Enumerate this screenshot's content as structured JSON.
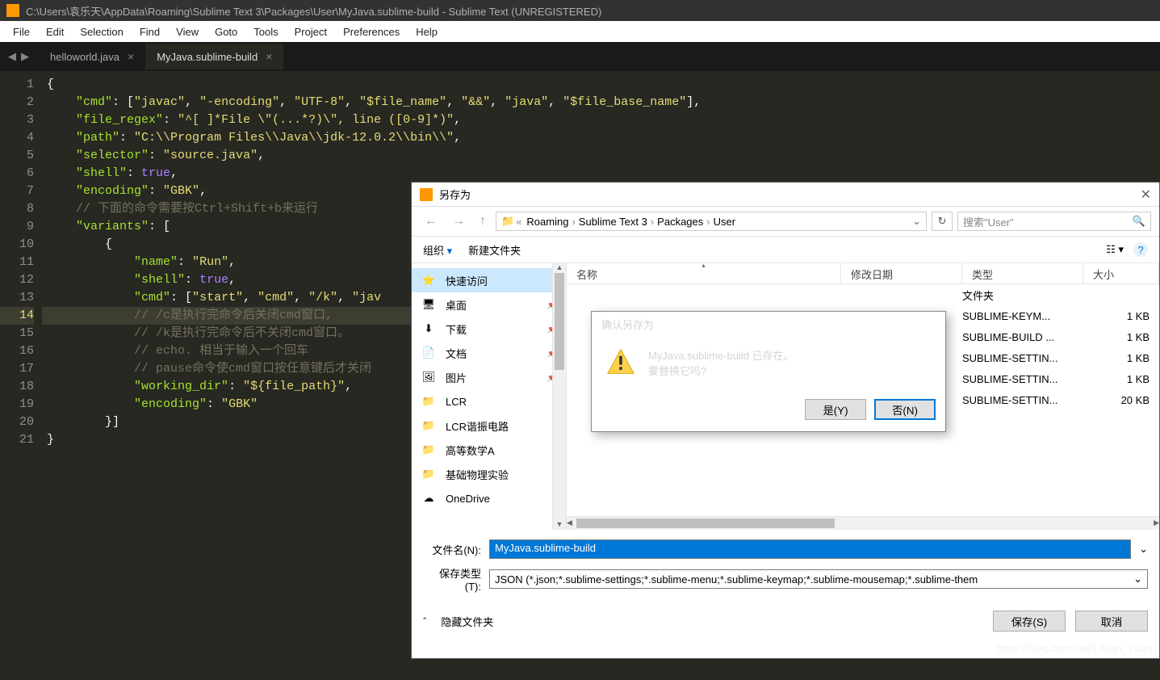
{
  "titlebar": {
    "path": "C:\\Users\\袁乐天\\AppData\\Roaming\\Sublime Text 3\\Packages\\User\\MyJava.sublime-build - Sublime Text (UNREGISTERED)"
  },
  "menu": [
    "File",
    "Edit",
    "Selection",
    "Find",
    "View",
    "Goto",
    "Tools",
    "Project",
    "Preferences",
    "Help"
  ],
  "tabs": [
    {
      "label": "helloworld.java",
      "active": false
    },
    {
      "label": "MyJava.sublime-build",
      "active": true
    }
  ],
  "code_lines": [
    {
      "n": 1,
      "html": "<span class='s-p'>{</span>"
    },
    {
      "n": 2,
      "html": "    <span class='s-k'>\"cmd\"</span><span class='s-p'>: [</span><span class='s-s'>\"javac\"</span><span class='s-p'>, </span><span class='s-s'>\"-encoding\"</span><span class='s-p'>, </span><span class='s-s'>\"UTF-8\"</span><span class='s-p'>, </span><span class='s-s'>\"$file_name\"</span><span class='s-p'>, </span><span class='s-s'>\"&amp;&amp;\"</span><span class='s-p'>, </span><span class='s-s'>\"java\"</span><span class='s-p'>, </span><span class='s-s'>\"$file_base_name\"</span><span class='s-p'>],</span>"
    },
    {
      "n": 3,
      "html": "    <span class='s-k'>\"file_regex\"</span><span class='s-p'>: </span><span class='s-s'>\"^[ ]*File \\\"(...*?)\\\", line ([0-9]*)\"</span><span class='s-p'>,</span>"
    },
    {
      "n": 4,
      "html": "    <span class='s-k'>\"path\"</span><span class='s-p'>: </span><span class='s-s'>\"C:\\\\Program Files\\\\Java\\\\jdk-12.0.2\\\\bin\\\\\"</span><span class='s-p'>,</span>"
    },
    {
      "n": 5,
      "html": "    <span class='s-k'>\"selector\"</span><span class='s-p'>: </span><span class='s-s'>\"source.java\"</span><span class='s-p'>,</span>"
    },
    {
      "n": 6,
      "html": "    <span class='s-k'>\"shell\"</span><span class='s-p'>: </span><span class='s-b'>true</span><span class='s-p'>,</span>"
    },
    {
      "n": 7,
      "html": "    <span class='s-k'>\"encoding\"</span><span class='s-p'>: </span><span class='s-s'>\"GBK\"</span><span class='s-p'>,</span>"
    },
    {
      "n": 8,
      "html": "    <span class='s-c'>// 下面的命令需要按Ctrl+Shift+b来运行</span>"
    },
    {
      "n": 9,
      "html": "    <span class='s-k'>\"variants\"</span><span class='s-p'>: [</span>"
    },
    {
      "n": 10,
      "html": "        <span class='s-p'>{</span>"
    },
    {
      "n": 11,
      "html": "            <span class='s-k'>\"name\"</span><span class='s-p'>: </span><span class='s-s'>\"Run\"</span><span class='s-p'>,</span>"
    },
    {
      "n": 12,
      "html": "            <span class='s-k'>\"shell\"</span><span class='s-p'>: </span><span class='s-b'>true</span><span class='s-p'>,</span>"
    },
    {
      "n": 13,
      "html": "            <span class='s-k'>\"cmd\"</span><span class='s-p'>: [</span><span class='s-s'>\"start\"</span><span class='s-p'>, </span><span class='s-s'>\"cmd\"</span><span class='s-p'>, </span><span class='s-s'>\"/k\"</span><span class='s-p'>, </span><span class='s-s'>\"jav</span>"
    },
    {
      "n": 14,
      "html": "            <span class='s-c'>// /c是执行完命令后关闭cmd窗口,</span>",
      "hl": true
    },
    {
      "n": 15,
      "html": "            <span class='s-c'>// /k是执行完命令后不关闭cmd窗口。</span>"
    },
    {
      "n": 16,
      "html": "            <span class='s-c'>// echo. 相当于输入一个回车</span>"
    },
    {
      "n": 17,
      "html": "            <span class='s-c'>// pause命令使cmd窗口按任意键后才关闭</span>"
    },
    {
      "n": 18,
      "html": "            <span class='s-k'>\"working_dir\"</span><span class='s-p'>: </span><span class='s-s'>\"${file_path}\"</span><span class='s-p'>,</span>"
    },
    {
      "n": 19,
      "html": "            <span class='s-k'>\"encoding\"</span><span class='s-p'>: </span><span class='s-s'>\"GBK\"</span>"
    },
    {
      "n": 20,
      "html": "        <span class='s-p'>}]</span>"
    },
    {
      "n": 21,
      "html": "<span class='s-p'>}</span>"
    }
  ],
  "saveDialog": {
    "title": "另存为",
    "breadcrumb": [
      "Roaming",
      "Sublime Text 3",
      "Packages",
      "User"
    ],
    "searchPlaceholder": "搜索\"User\"",
    "toolbar": {
      "organize": "组织",
      "newFolder": "新建文件夹"
    },
    "columns": {
      "name": "名称",
      "date": "修改日期",
      "type": "类型",
      "size": "大小"
    },
    "sidebar": [
      {
        "label": "快速访问",
        "icon": "star",
        "sel": true,
        "pin": false
      },
      {
        "label": "桌面",
        "icon": "desktop",
        "pin": true
      },
      {
        "label": "下载",
        "icon": "download",
        "pin": true
      },
      {
        "label": "文档",
        "icon": "doc",
        "pin": true
      },
      {
        "label": "图片",
        "icon": "pic",
        "pin": true
      },
      {
        "label": "LCR",
        "icon": "folder",
        "pin": false
      },
      {
        "label": "LCR谐振电路",
        "icon": "folder",
        "pin": false
      },
      {
        "label": "高等数学A",
        "icon": "folder",
        "pin": false
      },
      {
        "label": "基础物理实验",
        "icon": "folder",
        "pin": false
      },
      {
        "label": "OneDrive",
        "icon": "cloud",
        "pin": false
      }
    ],
    "files": [
      {
        "name": "",
        "date": "",
        "type": "文件夹",
        "size": ""
      },
      {
        "name": "",
        "date": "",
        "type": "SUBLIME-KEYM...",
        "size": "1 KB"
      },
      {
        "name": "",
        "date": "",
        "type": "SUBLIME-BUILD ...",
        "size": "1 KB"
      },
      {
        "name": "",
        "date": "",
        "type": "SUBLIME-SETTIN...",
        "size": "1 KB"
      },
      {
        "name": "",
        "date": "",
        "type": "SUBLIME-SETTIN...",
        "size": "1 KB"
      },
      {
        "name": "",
        "date": "",
        "type": "SUBLIME-SETTIN...",
        "size": "20 KB"
      }
    ],
    "fileNameLabel": "文件名(N):",
    "fileNameValue": "MyJava.sublime-build",
    "saveTypeLabel": "保存类型(T):",
    "saveTypeValue": "JSON (*.json;*.sublime-settings;*.sublime-menu;*.sublime-keymap;*.sublime-mousemap;*.sublime-them",
    "hideFolders": "隐藏文件夹",
    "saveBtn": "保存(S)",
    "cancelBtn": "取消"
  },
  "confirm": {
    "title": "确认另存为",
    "line1": "MyJava.sublime-build 已存在。",
    "line2": "要替换它吗?",
    "yes": "是(Y)",
    "no": "否(N)"
  },
  "watermark": "https://blog.csdn.net/Letian_Yuan"
}
